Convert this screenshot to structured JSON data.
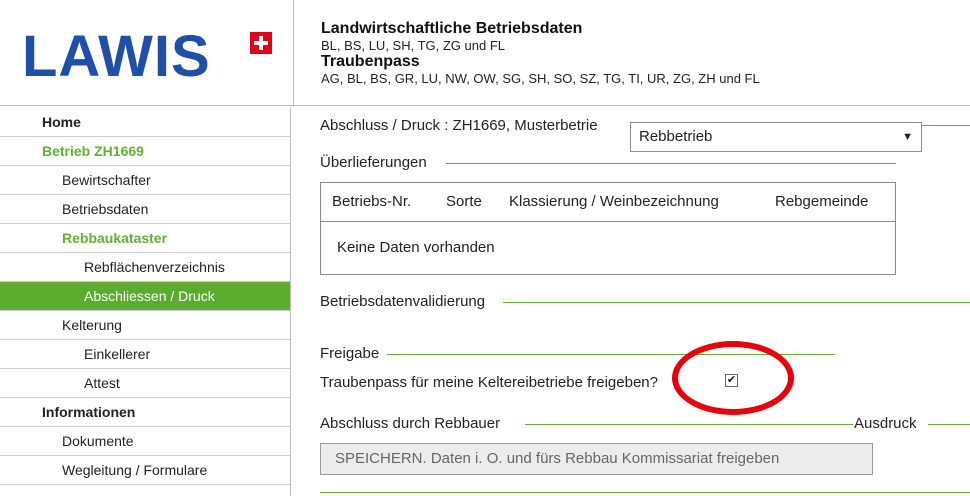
{
  "header": {
    "logo": "LAWIS",
    "title1": "Landwirtschaftliche Betriebsdaten",
    "sub1": "BL, BS, LU, SH, TG, ZG und FL",
    "title2": "Traubenpass",
    "sub2": "AG, BL, BS, GR, LU, NW, OW, SG, SH, SO, SZ, TG, TI, UR, ZG, ZH und FL"
  },
  "sidebar": {
    "items": [
      {
        "label": "Home"
      },
      {
        "label": "Betrieb ZH1669"
      },
      {
        "label": "Bewirtschafter"
      },
      {
        "label": "Betriebsdaten"
      },
      {
        "label": "Rebbaukataster"
      },
      {
        "label": "Rebflächenverzeichnis"
      },
      {
        "label": "Abschliessen / Druck"
      },
      {
        "label": "Kelterung"
      },
      {
        "label": "Einkellerer"
      },
      {
        "label": "Attest"
      },
      {
        "label": "Informationen"
      },
      {
        "label": "Dokumente"
      },
      {
        "label": "Wegleitung / Formulare"
      }
    ]
  },
  "main": {
    "breadcrumb": "Abschluss / Druck : ZH1669, Musterbetrie",
    "dropdown": {
      "selected": "Rebbetrieb",
      "arrow": "▼"
    },
    "ueberlieferungen": "Überlieferungen",
    "table": {
      "columns": [
        "Betriebs-Nr.",
        "Sorte",
        "Klassierung / Weinbezeichnung",
        "Rebgemeinde"
      ],
      "empty": "Keine Daten vorhanden"
    },
    "validierung": "Betriebsdatenvalidierung",
    "freigabe": "Freigabe",
    "freigabe_question": "Traubenpass für meine Keltereibetriebe freigeben?",
    "freigabe_checked": true,
    "check_mark": "✔",
    "abschluss": "Abschluss durch Rebbauer",
    "ausdruck": "Ausdruck",
    "save_button": "SPEICHERN. Daten i. O. und fürs Rebbau Kommissariat freigeben"
  },
  "colors": {
    "brand_blue": "#1f4fa8",
    "swiss_red": "#e2001a",
    "accent_green": "#5aab2e",
    "annotation_red": "#e8000d"
  }
}
